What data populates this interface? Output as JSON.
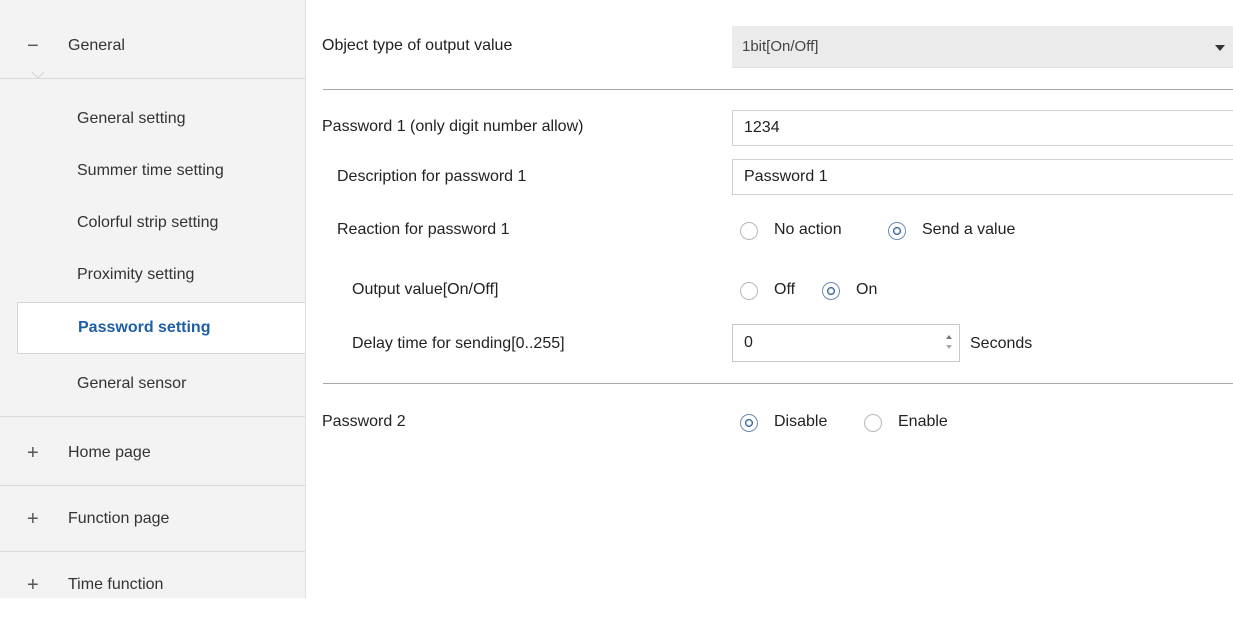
{
  "sidebar": {
    "general": {
      "sign": "−",
      "label": "General"
    },
    "items": [
      {
        "label": "General setting"
      },
      {
        "label": "Summer time setting"
      },
      {
        "label": "Colorful strip setting"
      },
      {
        "label": "Proximity setting"
      },
      {
        "label": "Password setting"
      },
      {
        "label": "General sensor"
      }
    ],
    "sections": [
      {
        "sign": "+",
        "label": "Home page"
      },
      {
        "sign": "+",
        "label": "Function page"
      },
      {
        "sign": "+",
        "label": "Time function"
      }
    ]
  },
  "form": {
    "object_type": {
      "label": "Object type of output value",
      "value": "1bit[On/Off]"
    },
    "password1": {
      "label": "Password 1 (only digit number allow)",
      "value": "1234"
    },
    "description1": {
      "label": "Description for password 1",
      "value": "Password 1"
    },
    "reaction1": {
      "label": "Reaction for password 1",
      "options": [
        "No action",
        "Send a value"
      ],
      "selected": "Send a value"
    },
    "output_value": {
      "label": "Output value[On/Off]",
      "options": [
        "Off",
        "On"
      ],
      "selected": "On"
    },
    "delay": {
      "label": "Delay time for sending[0..255]",
      "value": "0",
      "unit": "Seconds"
    },
    "password2": {
      "label": "Password 2",
      "options": [
        "Disable",
        "Enable"
      ],
      "selected": "Disable"
    }
  }
}
